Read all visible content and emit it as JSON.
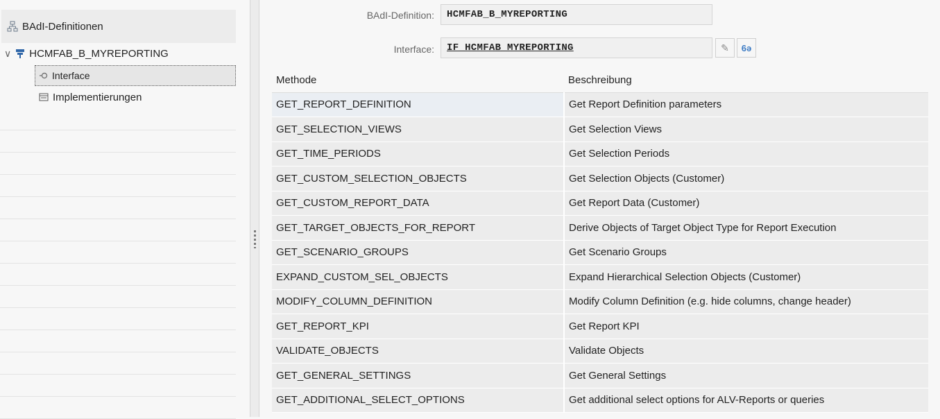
{
  "tree": {
    "root_label": "BAdI-Definitionen",
    "definition_label": "HCMFAB_B_MYREPORTING",
    "interface_label": "Interface",
    "implementations_label": "Implementierungen"
  },
  "form": {
    "badi_label": "BAdI-Definition:",
    "badi_value": "HCMFAB_B_MYREPORTING",
    "interface_label": "Interface:",
    "interface_value": "IF_HCMFAB_MYREPORTING"
  },
  "table": {
    "headers": [
      "Methode",
      "Beschreibung"
    ],
    "rows": [
      [
        "GET_REPORT_DEFINITION",
        "Get Report Definition parameters"
      ],
      [
        "GET_SELECTION_VIEWS",
        "Get Selection Views"
      ],
      [
        "GET_TIME_PERIODS",
        "Get Selection Periods"
      ],
      [
        "GET_CUSTOM_SELECTION_OBJECTS",
        "Get Selection Objects (Customer)"
      ],
      [
        "GET_CUSTOM_REPORT_DATA",
        "Get Report Data (Customer)"
      ],
      [
        "GET_TARGET_OBJECTS_FOR_REPORT",
        "Derive Objects of Target Object Type for Report Execution"
      ],
      [
        "GET_SCENARIO_GROUPS",
        "Get Scenario Groups"
      ],
      [
        "EXPAND_CUSTOM_SEL_OBJECTS",
        "Expand Hierarchical Selection Objects (Customer)"
      ],
      [
        "MODIFY_COLUMN_DEFINITION",
        "Modify Column Definition (e.g. hide columns, change header)"
      ],
      [
        "GET_REPORT_KPI",
        "Get Report KPI"
      ],
      [
        "VALIDATE_OBJECTS",
        "Validate Objects"
      ],
      [
        "GET_GENERAL_SETTINGS",
        "Get General Settings"
      ],
      [
        "GET_ADDITIONAL_SELECT_OPTIONS",
        "Get additional select options for ALV-Reports or queries"
      ]
    ]
  },
  "icons": {
    "hierarchy": "hierarchy-icon",
    "definition": "badi-definition-icon",
    "interface": "interface-icon",
    "implementations": "implementations-icon",
    "edit": "pencil-icon",
    "display": "glasses-icon"
  },
  "colors": {
    "frame": "#8fb2d4",
    "accent_icon": "#2f66a8"
  }
}
